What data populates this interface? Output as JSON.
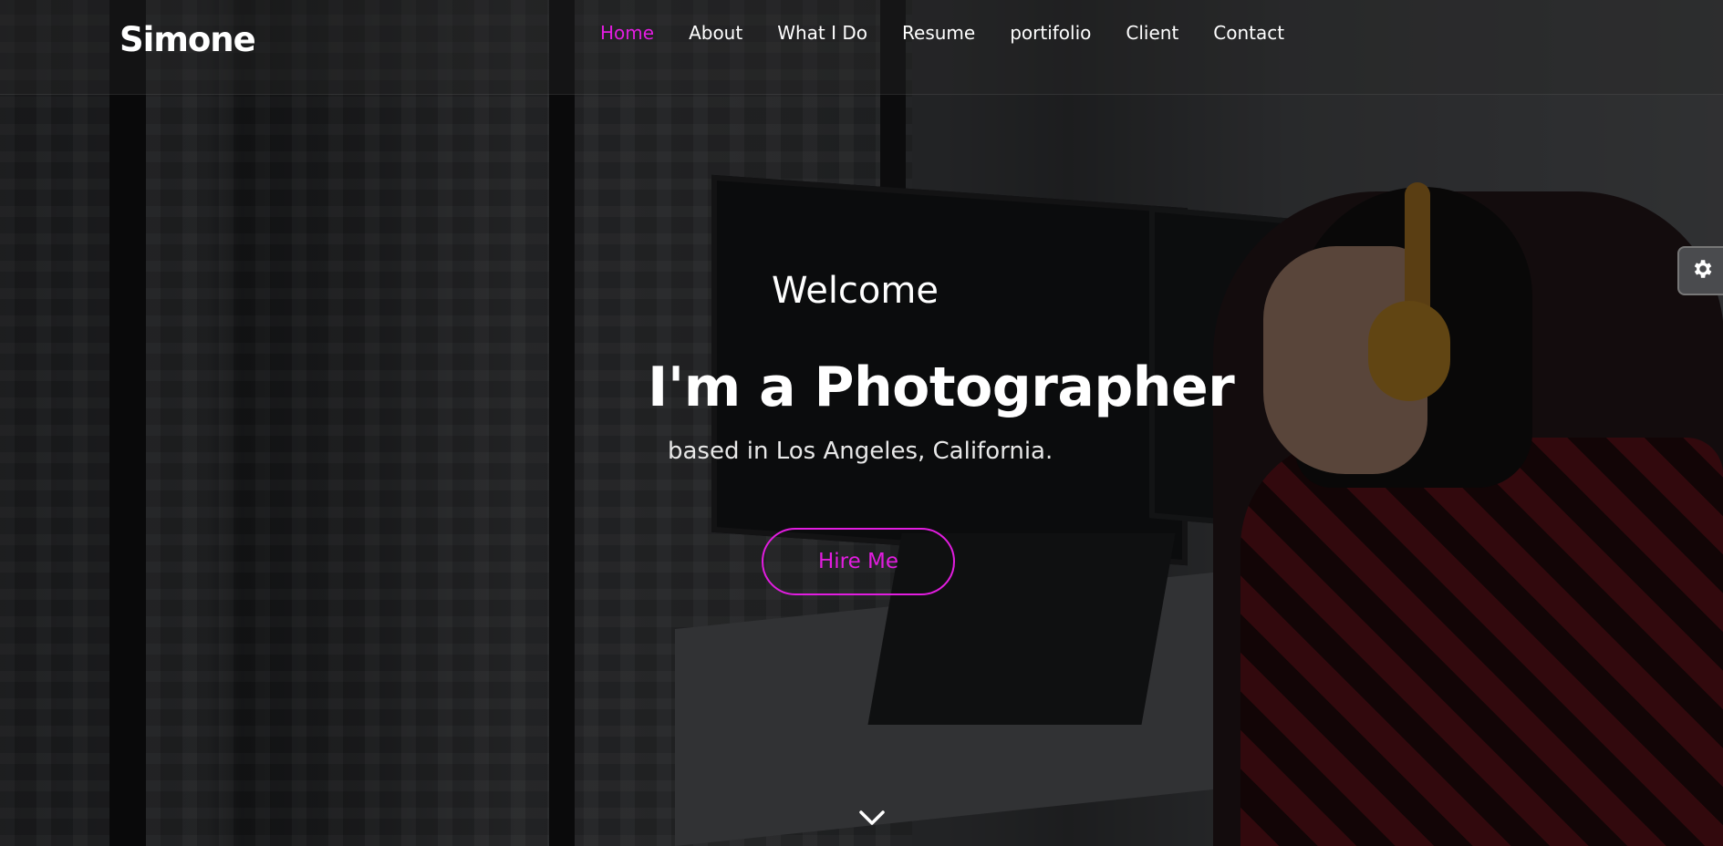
{
  "brand": {
    "name": "Simone"
  },
  "nav": {
    "items": [
      {
        "label": "Home",
        "active": true
      },
      {
        "label": "About",
        "active": false
      },
      {
        "label": "What I Do",
        "active": false
      },
      {
        "label": "Resume",
        "active": false
      },
      {
        "label": "portifolio",
        "active": false
      },
      {
        "label": "Client",
        "active": false
      },
      {
        "label": "Contact",
        "active": false
      }
    ]
  },
  "hero": {
    "greeting": "Welcome",
    "headline": "I'm a Photographer",
    "subline": "based in Los Angeles, California.",
    "cta_label": "Hire Me"
  },
  "icons": {
    "scroll": "chevron-down-icon",
    "settings": "gear-icon"
  },
  "colors": {
    "accent": "#e21de0",
    "text": "#ffffff"
  }
}
